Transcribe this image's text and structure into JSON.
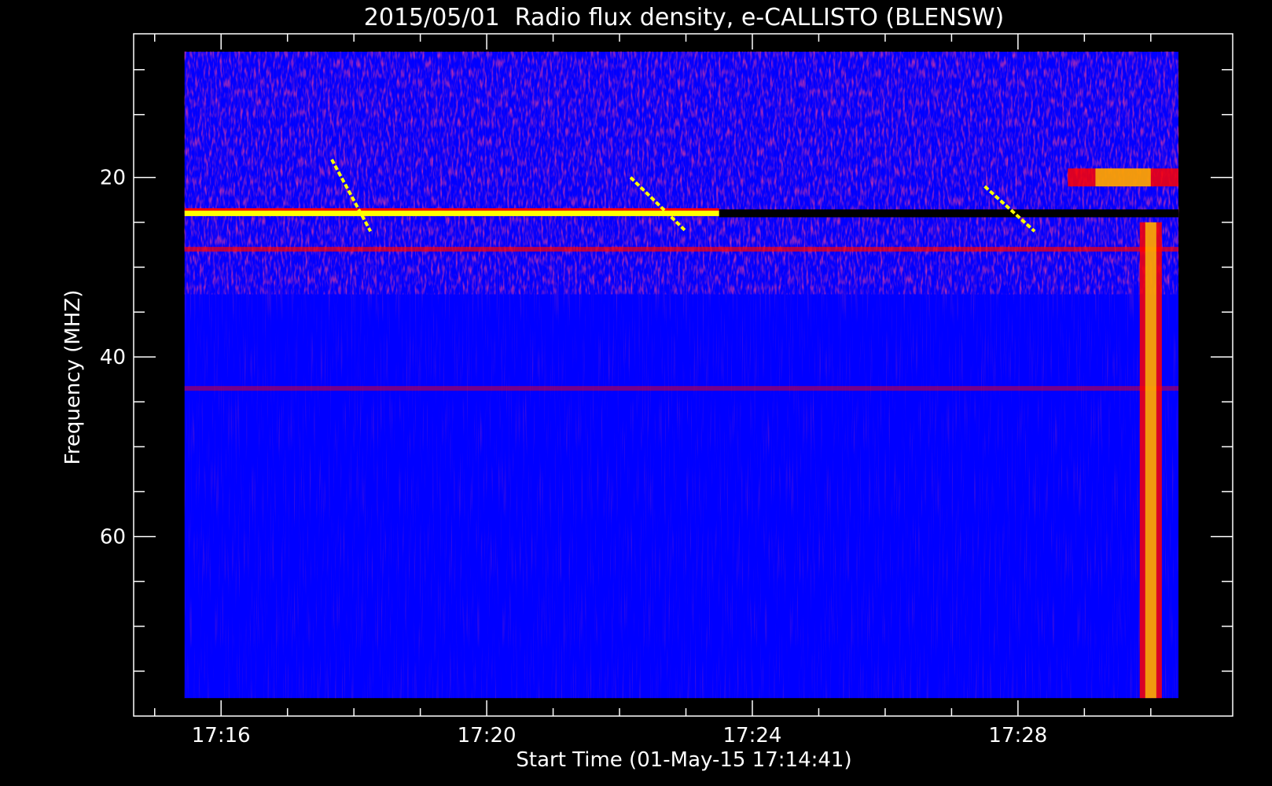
{
  "chart_data": {
    "type": "heatmap",
    "title": "2015/05/01  Radio flux density, e-CALLISTO (BLENSW)",
    "xlabel": "Start Time (01-May-15 17:14:41)",
    "ylabel": "Frequency (MHZ)",
    "x_unit": "time",
    "xlim": [
      "17:14:41",
      "17:31:14"
    ],
    "data_x_range": [
      "17:15:27",
      "17:30:25"
    ],
    "ylim": [
      4,
      80
    ],
    "data_y_range": [
      6,
      78
    ],
    "y_inverted": true,
    "x_major_ticks": [
      "17:16",
      "17:20",
      "17:24",
      "17:28"
    ],
    "x_minor_ticks": [
      "17:15",
      "17:17",
      "17:18",
      "17:19",
      "17:21",
      "17:22",
      "17:23",
      "17:25",
      "17:26",
      "17:27",
      "17:29",
      "17:30"
    ],
    "y_major_ticks": [
      20,
      40,
      60
    ],
    "y_minor_ticks": [
      8,
      13,
      25,
      30,
      35,
      45,
      50,
      55,
      65,
      70,
      75
    ],
    "colormap": [
      "#000000",
      "#0000ff",
      "#ff0000",
      "#ffff00"
    ],
    "background_color": "#0000ff",
    "features": [
      {
        "label": "continuous emission band",
        "y": 24,
        "x": [
          "17:15:27",
          "17:23:30"
        ],
        "intensity": "high"
      },
      {
        "label": "data gap",
        "y": 24,
        "x": [
          "17:23:30",
          "17:30:25"
        ],
        "intensity": "none"
      },
      {
        "label": "burst drift",
        "y": [
          18,
          26
        ],
        "x": [
          "17:17:40",
          "17:18:15"
        ],
        "intensity": "high"
      },
      {
        "label": "burst drift",
        "y": [
          20,
          26
        ],
        "x": [
          "17:22:10",
          "17:23:00"
        ],
        "intensity": "high"
      },
      {
        "label": "burst drift",
        "y": [
          21,
          26
        ],
        "x": [
          "17:27:30",
          "17:28:15"
        ],
        "intensity": "high"
      },
      {
        "label": "interference band",
        "y": 28,
        "x": [
          "17:15:27",
          "17:30:25"
        ],
        "intensity": "medium"
      },
      {
        "label": "interference band",
        "y": 43.5,
        "x": [
          "17:15:27",
          "17:30:25"
        ],
        "intensity": "low"
      },
      {
        "label": "broadband emission",
        "y": [
          25,
          78
        ],
        "x": [
          "17:29:50",
          "17:30:10"
        ],
        "intensity": "high"
      },
      {
        "label": "narrowband emission",
        "y": [
          19,
          21
        ],
        "x": [
          "17:28:45",
          "17:30:25"
        ],
        "intensity": "high"
      }
    ]
  }
}
